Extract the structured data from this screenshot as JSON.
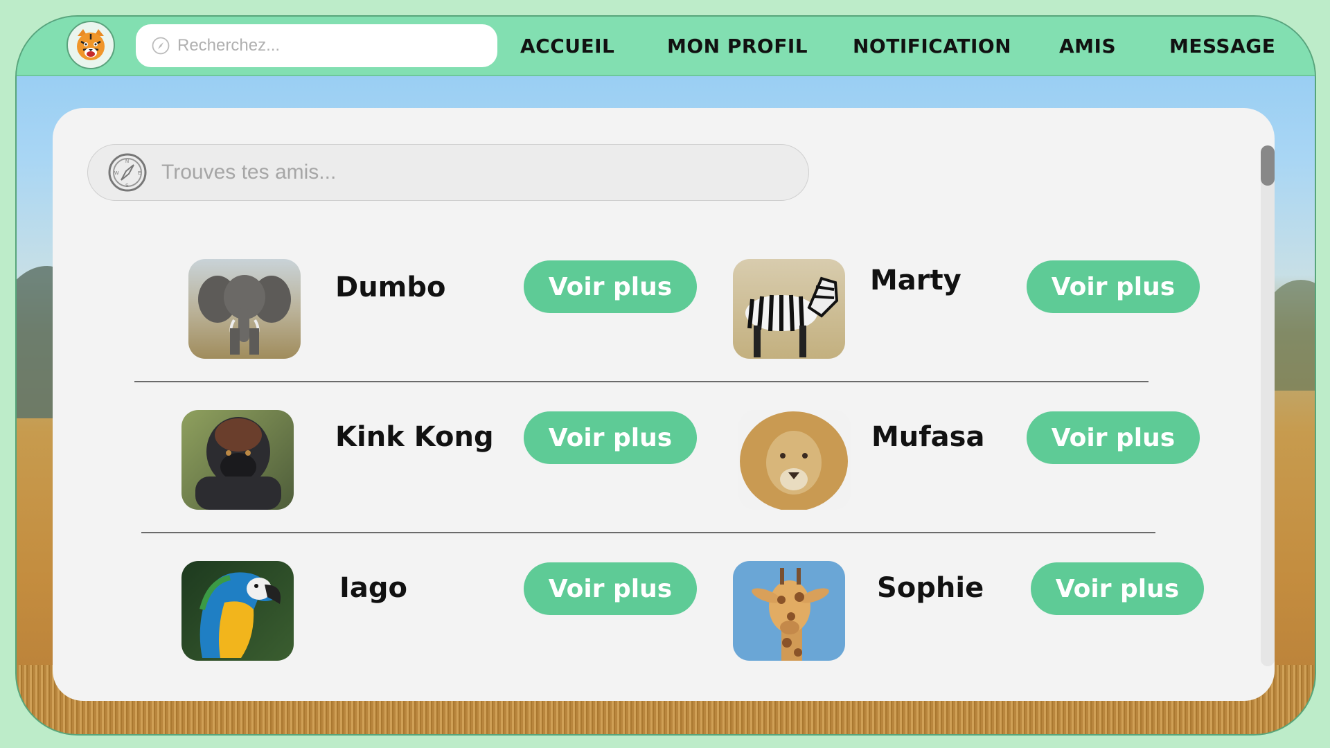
{
  "colors": {
    "accent": "#5ecb96",
    "topbar": "#82dfb1",
    "panel": "#f3f3f3",
    "page_bg": "#bdecc9"
  },
  "header": {
    "logo_icon": "tiger-icon",
    "search_placeholder": "Recherchez...",
    "nav": [
      "ACCUEIL",
      "MON PROFIL",
      "NOTIFICATION",
      "AMIS",
      "MESSAGE"
    ]
  },
  "friends_search": {
    "placeholder": "Trouves tes amis...",
    "icon": "compass-icon"
  },
  "friends": [
    {
      "name": "Dumbo",
      "animal": "elephant",
      "button": "Voir plus"
    },
    {
      "name": "Marty",
      "animal": "zebra",
      "button": "Voir plus"
    },
    {
      "name": "Kink Kong",
      "animal": "gorilla",
      "button": "Voir plus"
    },
    {
      "name": "Mufasa",
      "animal": "lion",
      "button": "Voir plus"
    },
    {
      "name": "Iago",
      "animal": "parrot",
      "button": "Voir plus"
    },
    {
      "name": "Sophie",
      "animal": "giraffe",
      "button": "Voir plus"
    }
  ]
}
